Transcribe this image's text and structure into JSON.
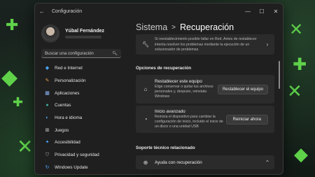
{
  "window": {
    "title": "Configuración",
    "controls": [
      "minimize-icon",
      "maximize-icon",
      "close-icon"
    ]
  },
  "profile": {
    "name": "Yúbal Fernández"
  },
  "search": {
    "placeholder": "Buscar una configuración"
  },
  "sidebar": {
    "items": [
      {
        "label": "Red e Internet",
        "icon": "wifi-icon",
        "color": "#4aa8ff"
      },
      {
        "label": "Personalización",
        "icon": "brush-icon",
        "color": "#e0a050"
      },
      {
        "label": "Aplicaciones",
        "icon": "apps-icon",
        "color": "#8ab4f8"
      },
      {
        "label": "Cuentas",
        "icon": "account-icon",
        "color": "#3fb0a0"
      },
      {
        "label": "Hora e idioma",
        "icon": "globe-clock-icon",
        "color": "#4aa8ff"
      },
      {
        "label": "Juegos",
        "icon": "gamepad-icon",
        "color": "#cfcfcf"
      },
      {
        "label": "Accesibilidad",
        "icon": "accessibility-icon",
        "color": "#4aa8ff"
      },
      {
        "label": "Privacidad y seguridad",
        "icon": "shield-icon",
        "color": "#9aa0a6"
      },
      {
        "label": "Windows Update",
        "icon": "update-icon",
        "color": "#4aa8ff"
      }
    ]
  },
  "header": {
    "crumb1": "Sistema",
    "separator": ">",
    "crumb2": "Recuperación"
  },
  "troubleshoot": {
    "title": "Si reestablecimiento posible fallar en Red, Antes de restablecer",
    "desc": "intenta resolver los problemas mediante la ejecución de un solucionador de problemas"
  },
  "recovery_section": "Opciones de recuperación",
  "reset": {
    "title": "Restablecer este equipo",
    "desc": "Elige conservar o quitar tus archivos personales y, después, reinstala Windows",
    "button": "Restablecer el equipo"
  },
  "advanced": {
    "title": "Inicio avanzado",
    "desc": "Reinicia el dispositivo para cambiar la configuración de inicio, incluido el inicio de un disco o una unidad USB",
    "button": "Reiniciar ahora"
  },
  "support_section": "Soporte técnico relacionado",
  "help": {
    "title": "Ayuda con recuperación"
  },
  "colors": {
    "accent": "#5fd24a",
    "window_bg": "#1f1f1f",
    "card_bg": "#2b2b2b"
  }
}
